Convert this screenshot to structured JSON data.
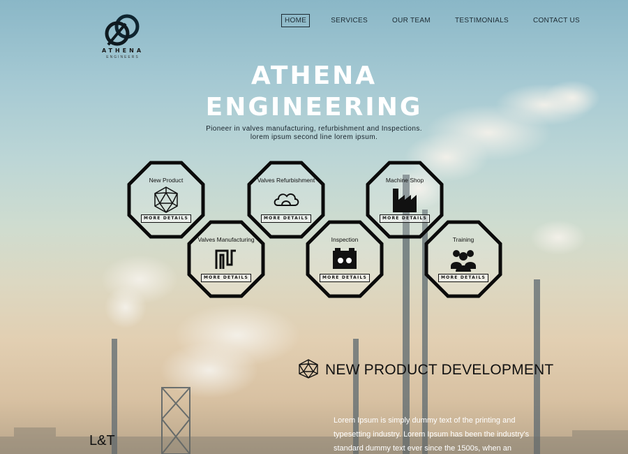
{
  "brand": {
    "name": "ATHENA",
    "tagline": "ENGINEERS"
  },
  "nav": {
    "items": [
      {
        "label": "HOME",
        "active": true
      },
      {
        "label": "SERVICES",
        "active": false
      },
      {
        "label": "OUR TEAM",
        "active": false
      },
      {
        "label": "TESTIMONIALS",
        "active": false
      },
      {
        "label": "CONTACT US",
        "active": false
      }
    ]
  },
  "hero": {
    "title_line1": "ATHENA",
    "title_line2": "ENGINEERING",
    "subtitle_line1": "Pioneer in valves manufacturing, refurbishment and Inspections.",
    "subtitle_line2": "lorem ipsum second line lorem ipsum."
  },
  "services": [
    {
      "label": "New Product",
      "icon": "geodesic-sphere-icon",
      "button": "MORE DETAILS"
    },
    {
      "label": "Valves Refurbishment",
      "icon": "cloud-loop-icon",
      "button": "MORE DETAILS"
    },
    {
      "label": "Machine Shop",
      "icon": "factory-icon",
      "button": "MORE DETAILS"
    },
    {
      "label": "Valves Manufacturing",
      "icon": "valve-pipes-icon",
      "button": "MORE DETAILS"
    },
    {
      "label": "Inspection",
      "icon": "inspection-box-icon",
      "button": "MORE DETAILS"
    },
    {
      "label": "Training",
      "icon": "people-group-icon",
      "button": "MORE DETAILS"
    }
  ],
  "section": {
    "icon": "geodesic-sphere-icon",
    "title": "NEW PRODUCT DEVELOPMENT",
    "body_line1": "Lorem Ipsum is simply dummy text of the printing and",
    "body_line2": "typesetting industry. Lorem Ipsum has been the industry's",
    "body_line3": "standard dummy text ever since the 1500s, when an unknown"
  },
  "partner": {
    "label": "L&T"
  },
  "colors": {
    "accent": "#111111",
    "hero_text": "#ffffff",
    "sky_top": "#8ab7c7",
    "haze_bottom": "#d8c1a2"
  }
}
